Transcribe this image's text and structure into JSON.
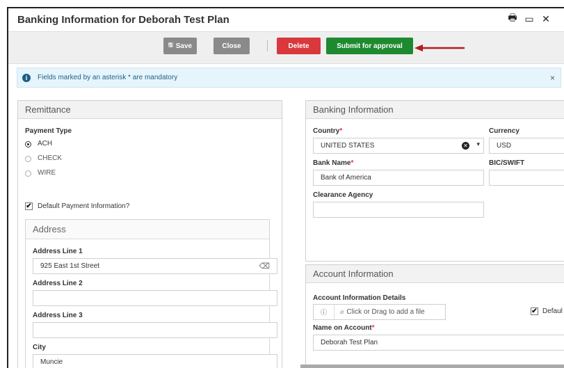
{
  "window": {
    "title": "Banking Information for Deborah Test Plan",
    "icons": [
      "printer-icon",
      "maximize-icon",
      "close-icon"
    ],
    "icon_glyphs": [
      "🖶",
      "▭",
      "✕"
    ]
  },
  "toolbar": {
    "save_label": "Save",
    "save_icon": "🖫",
    "close_label": "Close",
    "delete_label": "Delete",
    "submit_label": "Submit for approval",
    "annotation_color": "#b21e1e"
  },
  "alert": {
    "icon": "i",
    "text": "Fields marked by an asterisk * are mandatory",
    "close": "×"
  },
  "remittance": {
    "title": "Remittance",
    "payment_type_label": "Payment Type",
    "options": [
      {
        "label": "ACH",
        "selected": true
      },
      {
        "label": "CHECK",
        "selected": false
      },
      {
        "label": "WIRE",
        "selected": false
      }
    ],
    "default_payment_label": "Default Payment Information?",
    "default_payment_checked": true,
    "address": {
      "title": "Address",
      "line1_label": "Address Line 1",
      "line1_value": "925 East 1st Street",
      "line2_label": "Address Line 2",
      "line2_value": "",
      "line3_label": "Address Line 3",
      "line3_value": "",
      "city_label": "City",
      "city_value": "Muncie"
    }
  },
  "banking": {
    "title": "Banking Information",
    "country_label": "Country",
    "country_value": "UNITED STATES",
    "currency_label": "Currency",
    "currency_value": "USD",
    "bank_name_label": "Bank Name",
    "bank_name_value": "Bank of America",
    "bic_label": "BIC/SWIFT",
    "bic_value": "",
    "clearance_label": "Clearance Agency",
    "clearance_value": "",
    "asterisk": "*"
  },
  "account": {
    "title": "Account Information",
    "details_label": "Account Information Details",
    "upload_info_icon": "ⓘ",
    "upload_text": "Click or Drag to add a file",
    "default_label": "Defaul",
    "default_checked": true,
    "name_label": "Name on Account",
    "name_value": "Deborah Test Plan"
  },
  "colors": {
    "save": "#8a8a8a",
    "delete": "#d9383d",
    "submit": "#1e8a2f",
    "alert_text": "#1f5e85"
  }
}
